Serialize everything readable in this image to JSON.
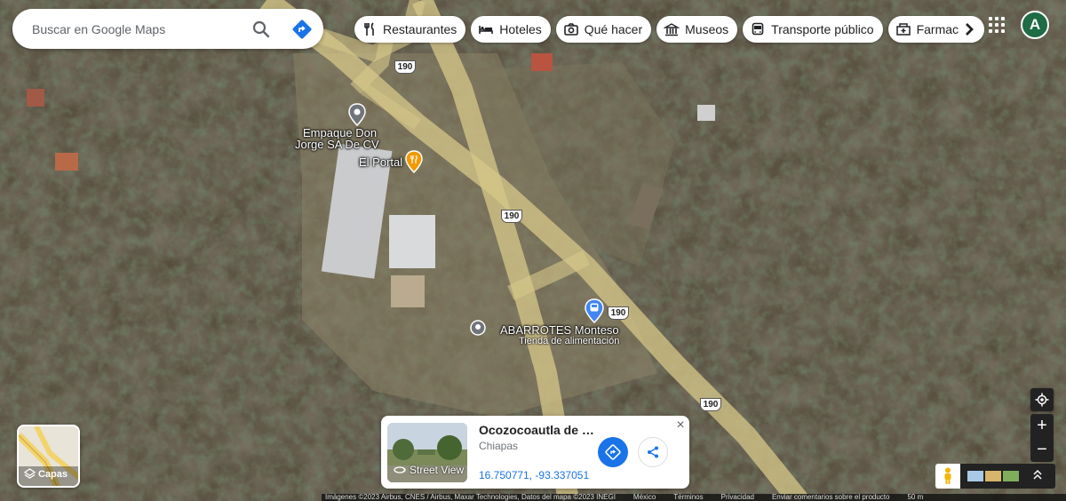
{
  "search": {
    "placeholder": "Buscar en Google Maps"
  },
  "icons": {
    "search": "search-icon",
    "directions": "directions-icon",
    "apps": "apps-grid-icon",
    "restaurants": "fork-knife-icon",
    "hotels": "bed-icon",
    "things_to_do": "camera-icon",
    "museums": "museum-icon",
    "transit": "bus-icon",
    "pharmacy": "pharmacy-icon"
  },
  "chips": [
    {
      "label": "Restaurantes"
    },
    {
      "label": "Hoteles"
    },
    {
      "label": "Qué hacer"
    },
    {
      "label": "Museos"
    },
    {
      "label": "Transporte público"
    },
    {
      "label": "Farmaci"
    }
  ],
  "account": {
    "initial": "A",
    "color": "#1e6b45"
  },
  "map": {
    "labels": {
      "place1_line1": "Empaque Don",
      "place1_line2": "Jorge SA De CV",
      "place2": "El Portal",
      "place3": "ABARROTES Monteso",
      "place3_category": "Tienda de alimentación"
    },
    "road_shields": [
      "190",
      "190",
      "190",
      "190"
    ]
  },
  "layers": {
    "label": "Capas"
  },
  "info_card": {
    "title": "Ocozocoautla de E...",
    "subtitle": "Chiapas",
    "coordinates": "16.750771, -93.337051",
    "street_view_label": "Street View",
    "close_symbol": "×"
  },
  "controls": {
    "zoom_in": "+",
    "zoom_out": "−"
  },
  "footer": {
    "attribution": "Imágenes ©2023 Airbus, CNES / Airbus, Maxar Technologies, Datos del mapa ©2023 INEGI",
    "country": "México",
    "terms": "Términos",
    "privacy": "Privacidad",
    "feedback": "Enviar comentarios sobre el producto",
    "scale": "50 m"
  },
  "colors": {
    "accent": "#1a73e8",
    "road": "#d7c88a"
  }
}
